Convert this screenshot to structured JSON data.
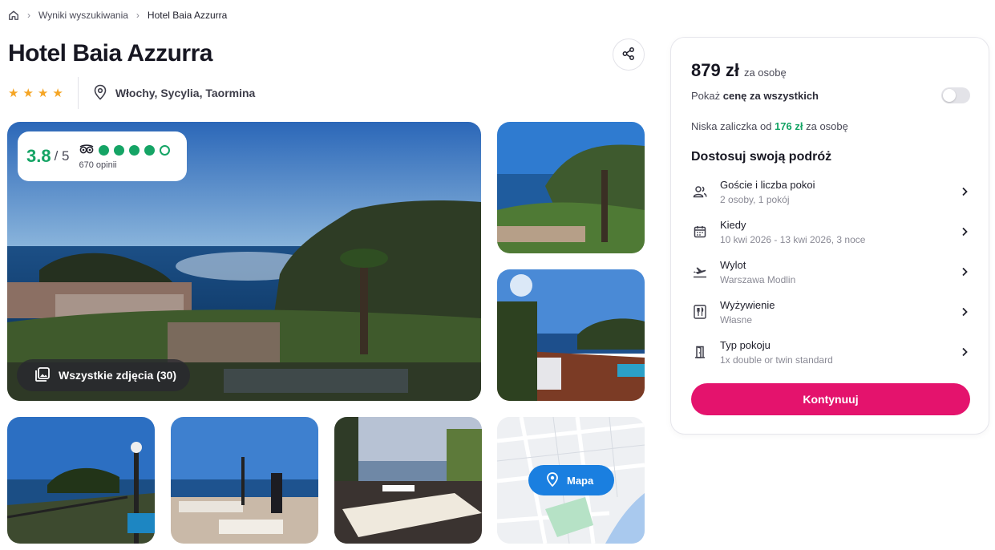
{
  "breadcrumb": {
    "items": [
      "Wyniki wyszukiwania",
      "Hotel Baia Azzurra"
    ]
  },
  "hotel": {
    "name": "Hotel Baia Azzurra",
    "stars": 4,
    "location": "Włochy, Sycylia, Taormina"
  },
  "rating": {
    "score": "3.8",
    "outof": "/ 5",
    "reviews": "670 opinii",
    "tripadvisor_bubbles": 4,
    "tripadvisor_max": 5
  },
  "gallery": {
    "all_photos_label": "Wszystkie zdjęcia (30)",
    "map_label": "Mapa"
  },
  "booking": {
    "price": "879 zł",
    "price_unit": "za osobę",
    "toggle_prefix": "Pokaż",
    "toggle_bold": "cenę za wszystkich",
    "toggle_on": false,
    "deposit_prefix": "Niska zaliczka od",
    "deposit_amount": "176 zł",
    "deposit_suffix": "za osobę",
    "section_title": "Dostosuj swoją podróż",
    "options": [
      {
        "label": "Goście i liczba pokoi",
        "value": "2 osoby, 1 pokój",
        "icon": "guests-icon"
      },
      {
        "label": "Kiedy",
        "value": "10 kwi 2026 - 13 kwi 2026, 3 noce",
        "icon": "calendar-icon"
      },
      {
        "label": "Wylot",
        "value": "Warszawa Modlin",
        "icon": "plane-icon"
      },
      {
        "label": "Wyżywienie",
        "value": "Własne",
        "icon": "cutlery-icon"
      },
      {
        "label": "Typ pokoju",
        "value": "1x double or twin standard",
        "icon": "door-icon"
      }
    ],
    "cta": "Kontynuuj"
  },
  "colors": {
    "accent": "#e4136d",
    "green": "#15a465",
    "star": "#f5a524",
    "map_button": "#1a7fe0"
  }
}
